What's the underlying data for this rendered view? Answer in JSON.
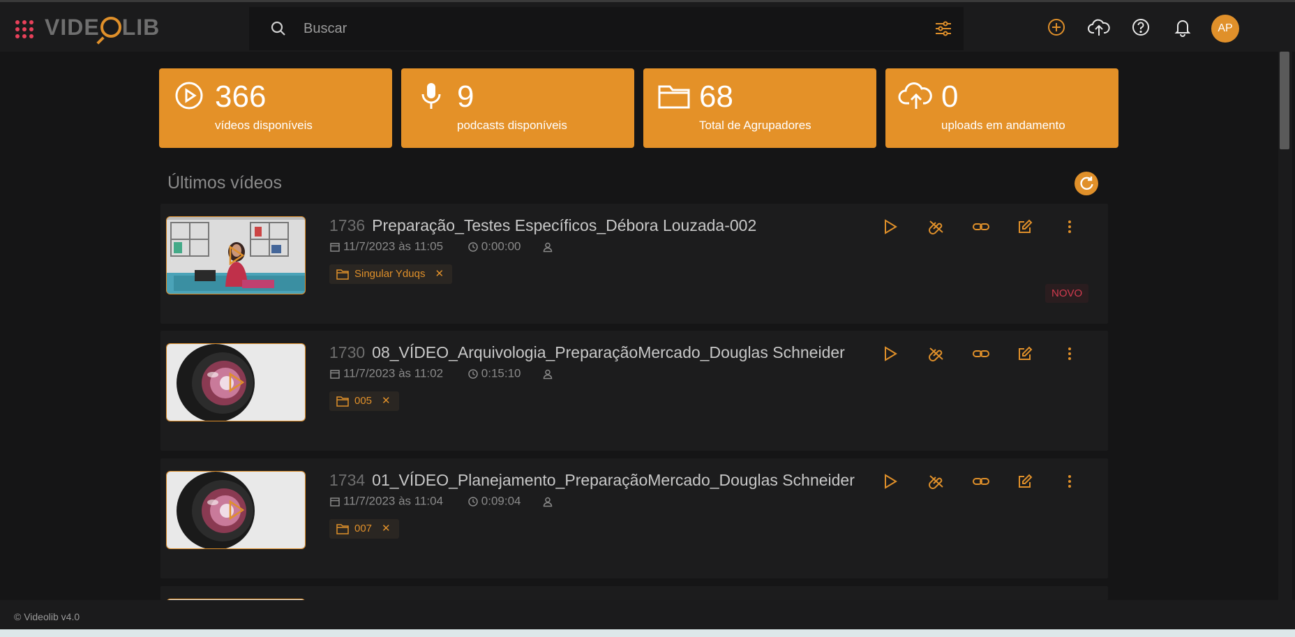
{
  "header": {
    "logo_text": "VIDEOLIB",
    "search_placeholder": "Buscar",
    "avatar_initials": "AP",
    "icons": [
      "apps-icon",
      "search-icon",
      "filter-icon",
      "add-icon",
      "upload-icon",
      "help-icon",
      "bell-icon"
    ]
  },
  "stats": [
    {
      "value": "366",
      "label": "vídeos disponíveis",
      "icon": "play-circle-icon"
    },
    {
      "value": "9",
      "label": "podcasts disponíveis",
      "icon": "microphone-icon"
    },
    {
      "value": "68",
      "label": "Total de Agrupadores",
      "icon": "folder-icon"
    },
    {
      "value": "0",
      "label": "uploads em andamento",
      "icon": "cloud-upload-icon"
    }
  ],
  "section_title": "Últimos vídeos",
  "videos": [
    {
      "id": "1736",
      "title": "Preparação_Testes Específicos_Débora Louzada-002",
      "date": "11/7/2023 às 11:05",
      "duration": "0:00:00",
      "tag": "Singular Yduqs",
      "badge": "NOVO",
      "thumb": "presenter"
    },
    {
      "id": "1730",
      "title": "08_VÍDEO_Arquivologia_PreparaçãoMercado_Douglas Schneider",
      "date": "11/7/2023 às 11:02",
      "duration": "0:15:10",
      "tag": "005",
      "badge": "",
      "thumb": "lens"
    },
    {
      "id": "1734",
      "title": "01_VÍDEO_Planejamento_PreparaçãoMercado_Douglas Schneider",
      "date": "11/7/2023 às 11:04",
      "duration": "0:09:04",
      "tag": "007",
      "badge": "",
      "thumb": "lens"
    }
  ],
  "footer": "© Videolib v4.0",
  "colors": {
    "accent": "#e49128",
    "badge_red": "#d23b4f",
    "background": "#151516"
  }
}
